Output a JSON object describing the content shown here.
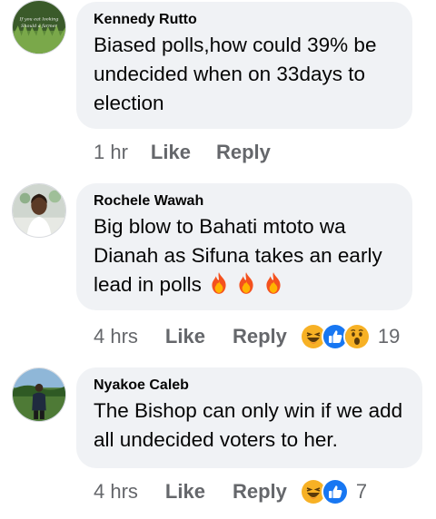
{
  "comments": [
    {
      "author": "Kennedy Rutto",
      "text": "Biased polls,how could 39% be undecided when on 33days to election",
      "avatar_text_1": "If you eat looking",
      "avatar_text_2": "Should a farmer",
      "time": "1 hr",
      "like_label": "Like",
      "reply_label": "Reply"
    },
    {
      "author": "Rochele Wawah",
      "text": "Big blow to Bahati mtoto wa Dianah as Sifuna takes an early lead in polls",
      "inline_emoji": [
        "fire-emoji",
        "fire-emoji",
        "fire-emoji"
      ],
      "time": "4 hrs",
      "like_label": "Like",
      "reply_label": "Reply",
      "reactions": [
        "haha-reaction",
        "like-reaction",
        "wow-reaction"
      ],
      "reaction_count": "19"
    },
    {
      "author": "Nyakoe Caleb",
      "text": "The Bishop can only win if we add all undecided voters to her.",
      "time": "4 hrs",
      "like_label": "Like",
      "reply_label": "Reply",
      "reactions": [
        "haha-reaction",
        "like-reaction"
      ],
      "reaction_count": "7"
    }
  ],
  "colors": {
    "bubble": "#f0f2f5",
    "meta_text": "#65676b",
    "like_blue": "#1877f2",
    "reaction_yellow": "#f7b125"
  }
}
